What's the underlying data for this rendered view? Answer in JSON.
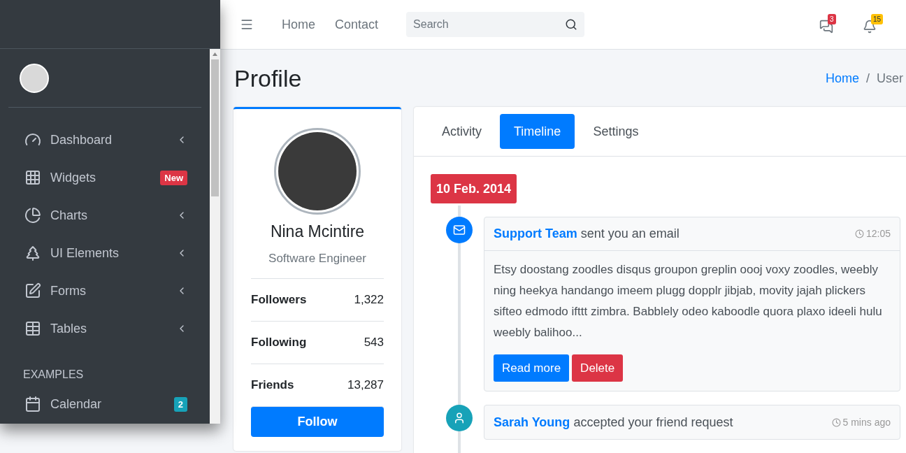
{
  "sidebar": {
    "menu": [
      {
        "label": "Dashboard",
        "has_submenu": true
      },
      {
        "label": "Widgets",
        "has_submenu": false,
        "badge": {
          "text": "New",
          "color": "#dc3545"
        }
      },
      {
        "label": "Charts",
        "has_submenu": true
      },
      {
        "label": "UI Elements",
        "has_submenu": true
      },
      {
        "label": "Forms",
        "has_submenu": true
      },
      {
        "label": "Tables",
        "has_submenu": true
      }
    ],
    "header": "EXAMPLES",
    "examples": [
      {
        "label": "Calendar",
        "has_submenu": false,
        "badge": {
          "text": "2",
          "color": "#17a2b8"
        }
      }
    ]
  },
  "navbar": {
    "links": [
      "Home",
      "Contact"
    ],
    "search": {
      "placeholder": "Search"
    },
    "notifications": [
      {
        "count": "3",
        "color": "#dc3545"
      },
      {
        "count": "15",
        "color": "#ffc107"
      }
    ]
  },
  "page_title": "Profile",
  "breadcrumb": [
    "Home",
    "User"
  ],
  "breadcrumb_separator": "/",
  "profile": {
    "name": "Nina Mcintire",
    "role": "Software Engineer",
    "stats": [
      {
        "label": "Followers",
        "value": "1,322"
      },
      {
        "label": "Following",
        "value": "543"
      },
      {
        "label": "Friends",
        "value": "13,287"
      }
    ],
    "button": "Follow"
  },
  "tabs": [
    {
      "label": "Activity",
      "selected": false
    },
    {
      "label": "Timeline",
      "selected": true
    },
    {
      "label": "Settings",
      "selected": false
    }
  ],
  "timeline": {
    "date": "10 Feb. 2014",
    "items": [
      {
        "kind": "email",
        "author": "Support Team",
        "action": "sent you an email",
        "time": "12:05",
        "body": "Etsy doostang zoodles disqus groupon greplin oooj voxy zoodles, weebly ning heekya handango imeem plugg dopplr jibjab, movity jajah plickers sifteo edmodo ifttt zimbra. Babblely odeo kaboodle quora plaxo ideeli hulu weebly balihoo...",
        "buttons": [
          {
            "label": "Read more",
            "kind": "primary"
          },
          {
            "label": "Delete",
            "kind": "danger"
          }
        ]
      },
      {
        "kind": "user",
        "author": "Sarah Young",
        "action": "accepted your friend request",
        "time": "5 mins ago"
      }
    ]
  }
}
